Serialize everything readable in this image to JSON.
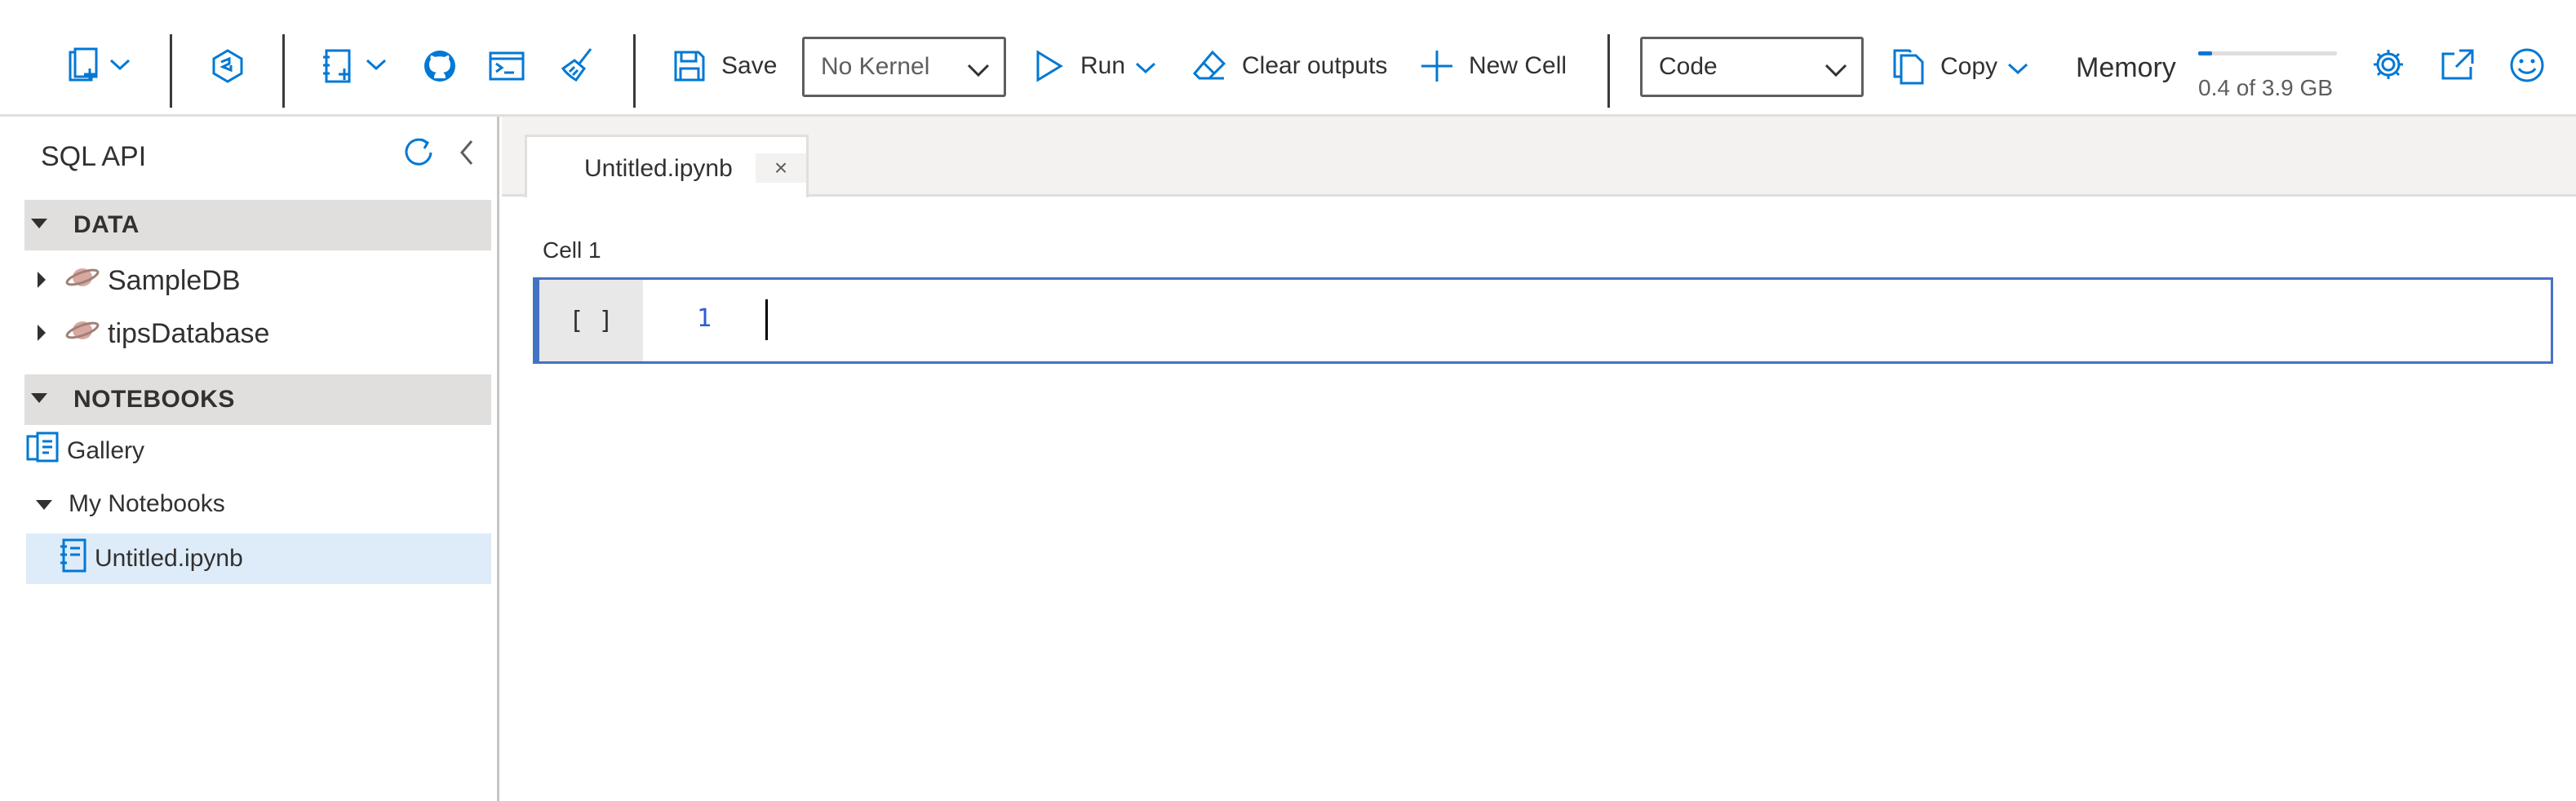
{
  "toolbar": {
    "save_label": "Save",
    "kernel_select": "No Kernel",
    "run_label": "Run",
    "clear_outputs_label": "Clear outputs",
    "new_cell_label": "New Cell",
    "cell_type_select": "Code",
    "copy_label": "Copy",
    "memory_label": "Memory",
    "memory_usage": "0.4 of 3.9 GB",
    "memory_fraction": 0.1,
    "accent_color": "#0078d4"
  },
  "sidebar": {
    "title": "SQL API",
    "sections": [
      {
        "label": "DATA",
        "items": [
          {
            "label": "SampleDB",
            "icon": "database-icon"
          },
          {
            "label": "tipsDatabase",
            "icon": "database-icon"
          }
        ]
      },
      {
        "label": "NOTEBOOKS",
        "items": [
          {
            "label": "Gallery",
            "icon": "gallery-icon"
          },
          {
            "label": "My Notebooks",
            "icon": "folder-expanded"
          },
          {
            "label": "Untitled.ipynb",
            "icon": "notebook-icon",
            "selected": true
          }
        ]
      }
    ]
  },
  "editor": {
    "tab_label": "Untitled.ipynb",
    "tab_close": "×",
    "cell_label": "Cell 1",
    "cell_prompt": "[ ]",
    "line_number": "1"
  }
}
